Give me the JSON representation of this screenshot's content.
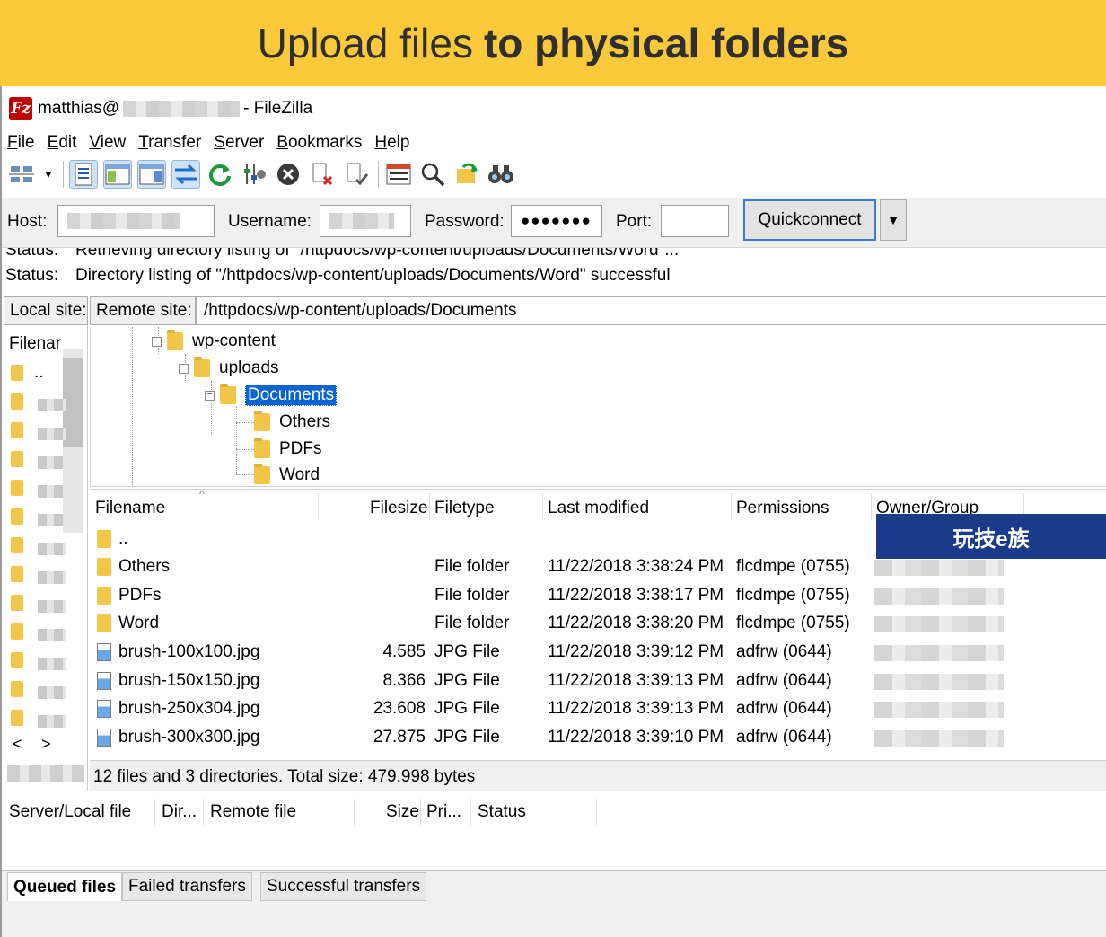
{
  "banner": {
    "text_regular": "Upload files",
    "text_bold": "to physical folders"
  },
  "window": {
    "user": "matthias@",
    "app": "- FileZilla"
  },
  "menu": [
    "File",
    "Edit",
    "View",
    "Transfer",
    "Server",
    "Bookmarks",
    "Help"
  ],
  "toolbar_icons": [
    "site-manager-icon",
    "dropdown-arrow-icon",
    "toggle-log-icon",
    "toggle-local-tree-icon",
    "toggle-remote-tree-icon",
    "toggle-queue-icon",
    "refresh-icon",
    "filter-settings-icon",
    "cancel-icon",
    "disconnect-icon",
    "reconnect-icon",
    "directory-listing-icon",
    "search-icon",
    "sync-browse-icon",
    "compare-icon"
  ],
  "quickconnect": {
    "host_label": "Host:",
    "username_label": "Username:",
    "password_label": "Password:",
    "password_value": "●●●●●●●",
    "port_label": "Port:",
    "port_value": "",
    "button_label": "Quickconnect",
    "dropdown": "▼"
  },
  "log": [
    {
      "label": "Status:",
      "text": "Retrieving directory listing of \"/httpdocs/wp-content/uploads/Documents/Word\"..."
    },
    {
      "label": "Status:",
      "text": "Directory listing of \"/httpdocs/wp-content/uploads/Documents/Word\" successful"
    }
  ],
  "local": {
    "label": "Local site:",
    "header": "Filenar",
    "parent": "..",
    "nav_left": "<",
    "nav_right": ">"
  },
  "remote": {
    "label": "Remote site:",
    "path": "/httpdocs/wp-content/uploads/Documents",
    "tree": [
      "wp-content",
      "uploads",
      "Documents",
      "Others",
      "PDFs",
      "Word"
    ],
    "columns": [
      "Filename",
      "Filesize",
      "Filetype",
      "Last modified",
      "Permissions",
      "Owner/Group"
    ],
    "files": [
      {
        "name": "..",
        "size": "",
        "type": "",
        "modified": "",
        "perms": "",
        "kind": "folder"
      },
      {
        "name": "Others",
        "size": "",
        "type": "File folder",
        "modified": "11/22/2018 3:38:24 PM",
        "perms": "flcdmpe (0755)",
        "kind": "folder"
      },
      {
        "name": "PDFs",
        "size": "",
        "type": "File folder",
        "modified": "11/22/2018 3:38:17 PM",
        "perms": "flcdmpe (0755)",
        "kind": "folder"
      },
      {
        "name": "Word",
        "size": "",
        "type": "File folder",
        "modified": "11/22/2018 3:38:20 PM",
        "perms": "flcdmpe (0755)",
        "kind": "folder"
      },
      {
        "name": "brush-100x100.jpg",
        "size": "4.585",
        "type": "JPG File",
        "modified": "11/22/2018 3:39:12 PM",
        "perms": "adfrw (0644)",
        "kind": "img"
      },
      {
        "name": "brush-150x150.jpg",
        "size": "8.366",
        "type": "JPG File",
        "modified": "11/22/2018 3:39:13 PM",
        "perms": "adfrw (0644)",
        "kind": "img"
      },
      {
        "name": "brush-250x304.jpg",
        "size": "23.608",
        "type": "JPG File",
        "modified": "11/22/2018 3:39:13 PM",
        "perms": "adfrw (0644)",
        "kind": "img"
      },
      {
        "name": "brush-300x300.jpg",
        "size": "27.875",
        "type": "JPG File",
        "modified": "11/22/2018 3:39:10 PM",
        "perms": "adfrw (0644)",
        "kind": "img"
      }
    ],
    "summary": "12 files and 3 directories. Total size: 479.998 bytes"
  },
  "queue": {
    "columns": [
      "Server/Local file",
      "Dir...",
      "Remote file",
      "Size",
      "Pri...",
      "Status"
    ]
  },
  "tabs": [
    "Queued files",
    "Failed transfers",
    "Successful transfers"
  ],
  "watermark": "玩技e族"
}
